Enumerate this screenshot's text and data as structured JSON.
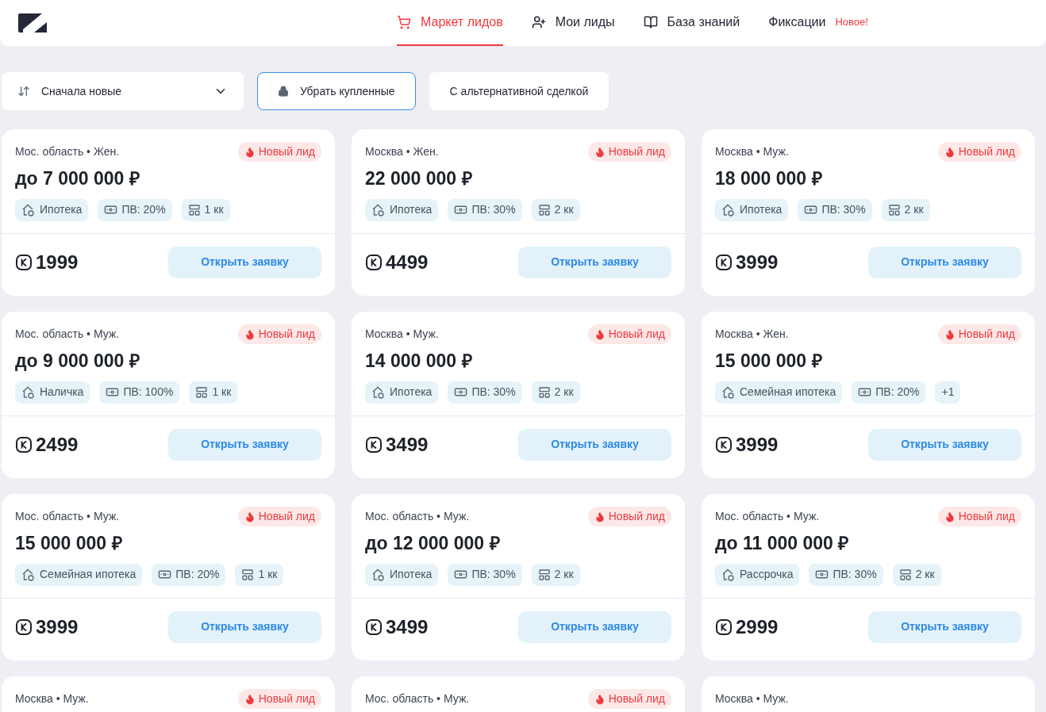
{
  "nav": [
    {
      "label": "Маркет лидов",
      "selected": true
    },
    {
      "label": "Мои лиды",
      "selected": false
    },
    {
      "label": "База знаний",
      "selected": false
    },
    {
      "label": "Фиксации",
      "selected": false,
      "badge": "Новое!"
    }
  ],
  "sort": {
    "value": "Сначала новые"
  },
  "filters": [
    {
      "label": "Убрать купленные",
      "selected": true
    },
    {
      "label": "С альтернативной сделкой",
      "selected": false
    }
  ],
  "cards": [
    {
      "location": "Мос. область • Жен.",
      "new": true,
      "badge": "Новый лид",
      "amount": "до 7 000 000 ₽",
      "tags": [
        {
          "kind": "program",
          "text": "Ипотека"
        },
        {
          "kind": "payment",
          "text": "ПВ: 20%"
        },
        {
          "kind": "rooms",
          "text": "1 кк"
        }
      ],
      "price": "1999",
      "button": "Открыть заявку"
    },
    {
      "location": "Москва • Жен.",
      "new": true,
      "badge": "Новый лид",
      "amount": "22 000 000 ₽",
      "tags": [
        {
          "kind": "program",
          "text": "Ипотека"
        },
        {
          "kind": "payment",
          "text": "ПВ: 30%"
        },
        {
          "kind": "rooms",
          "text": "2 кк"
        }
      ],
      "price": "4499",
      "button": "Открыть заявку"
    },
    {
      "location": "Москва • Муж.",
      "new": true,
      "badge": "Новый лид",
      "amount": "18 000 000 ₽",
      "tags": [
        {
          "kind": "program",
          "text": "Ипотека"
        },
        {
          "kind": "payment",
          "text": "ПВ: 30%"
        },
        {
          "kind": "rooms",
          "text": "2 кк"
        }
      ],
      "price": "3999",
      "button": "Открыть заявку"
    },
    {
      "location": "Мос. область • Муж.",
      "new": true,
      "badge": "Новый лид",
      "amount": "до 9 000 000 ₽",
      "tags": [
        {
          "kind": "program",
          "text": "Наличка"
        },
        {
          "kind": "payment",
          "text": "ПВ: 100%"
        },
        {
          "kind": "rooms",
          "text": "1 кк"
        }
      ],
      "price": "2499",
      "button": "Открыть заявку"
    },
    {
      "location": "Москва • Муж.",
      "new": true,
      "badge": "Новый лид",
      "amount": "14 000 000 ₽",
      "tags": [
        {
          "kind": "program",
          "text": "Ипотека"
        },
        {
          "kind": "payment",
          "text": "ПВ: 30%"
        },
        {
          "kind": "rooms",
          "text": "2 кк"
        }
      ],
      "price": "3499",
      "button": "Открыть заявку"
    },
    {
      "location": "Москва • Жен.",
      "new": true,
      "badge": "Новый лид",
      "amount": "15 000 000 ₽",
      "tags": [
        {
          "kind": "program",
          "text": "Семейная ипотека"
        },
        {
          "kind": "payment",
          "text": "ПВ: 20%"
        },
        {
          "kind": "more",
          "text": "+1"
        }
      ],
      "price": "3999",
      "button": "Открыть заявку"
    },
    {
      "location": "Мос. область • Муж.",
      "new": true,
      "badge": "Новый лид",
      "amount": "15 000 000 ₽",
      "tags": [
        {
          "kind": "program",
          "text": "Семейная ипотека"
        },
        {
          "kind": "payment",
          "text": "ПВ: 20%"
        },
        {
          "kind": "rooms",
          "text": "1 кк"
        }
      ],
      "price": "3999",
      "button": "Открыть заявку"
    },
    {
      "location": "Мос. область • Муж.",
      "new": true,
      "badge": "Новый лид",
      "amount": "до 12 000 000 ₽",
      "tags": [
        {
          "kind": "program",
          "text": "Ипотека"
        },
        {
          "kind": "payment",
          "text": "ПВ: 30%"
        },
        {
          "kind": "rooms",
          "text": "2 кк"
        }
      ],
      "price": "3499",
      "button": "Открыть заявку"
    },
    {
      "location": "Мос. область • Муж.",
      "new": true,
      "badge": "Новый лид",
      "amount": "до 11 000 000 ₽",
      "tags": [
        {
          "kind": "program",
          "text": "Рассрочка"
        },
        {
          "kind": "payment",
          "text": "ПВ: 30%"
        },
        {
          "kind": "rooms",
          "text": "2 кк"
        }
      ],
      "price": "2999",
      "button": "Открыть заявку"
    },
    {
      "location": "Москва • Муж.",
      "new": true,
      "badge": "Новый лид"
    },
    {
      "location": "Мос. область • Муж.",
      "new": true,
      "badge": "Новый лид"
    },
    {
      "location": "Москва • Муж.",
      "new": false
    }
  ]
}
